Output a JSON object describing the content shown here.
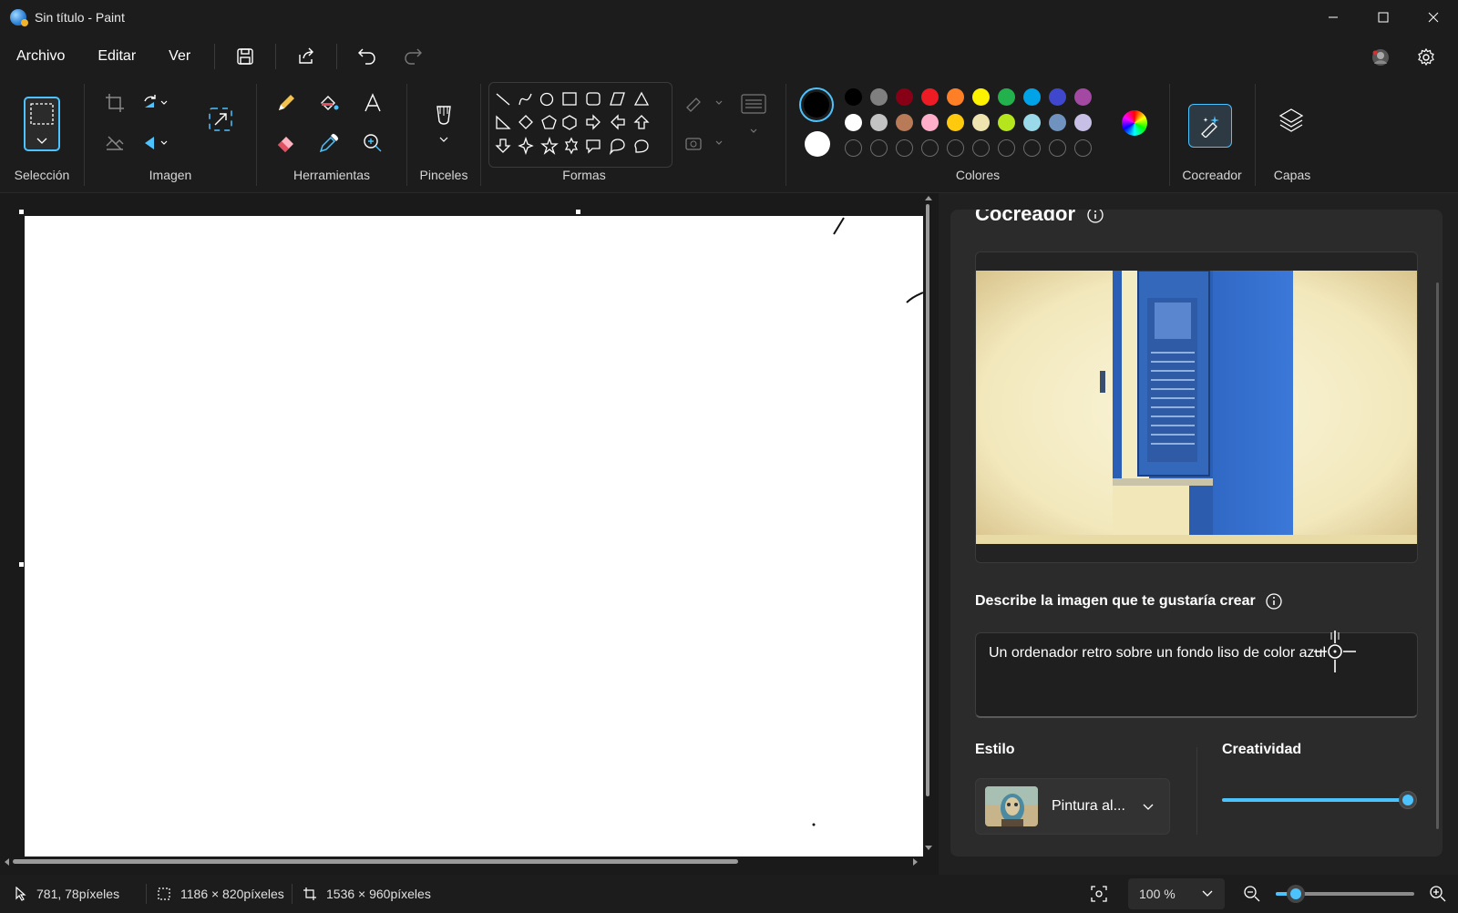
{
  "window": {
    "title": "Sin título - Paint"
  },
  "menu": {
    "file": "Archivo",
    "edit": "Editar",
    "view": "Ver"
  },
  "ribbon": {
    "groups": {
      "selection": "Selección",
      "image": "Imagen",
      "tools": "Herramientas",
      "brushes": "Pinceles",
      "shapes": "Formas",
      "colors": "Colores",
      "cocreator": "Cocreador",
      "layers": "Capas"
    },
    "palette_row1": [
      "#000000",
      "#7f7f7f",
      "#880015",
      "#ed1c24",
      "#ff7f27",
      "#fff200",
      "#22b14c",
      "#00a2e8",
      "#3f48cc",
      "#a349a4"
    ],
    "palette_row2": [
      "#ffffff",
      "#c3c3c3",
      "#b97a57",
      "#ffaec9",
      "#ffc90e",
      "#efe4b0",
      "#b5e61d",
      "#99d9ea",
      "#7092be",
      "#c8bfe7"
    ],
    "primary_color": "#000000",
    "secondary_color": "#ffffff",
    "accent": "#4cc2ff"
  },
  "cocreator": {
    "title": "Cocreador",
    "prompt_label": "Describe la imagen que te gustaría crear",
    "prompt_value": "Un ordenador retro sobre un fondo liso de color azul",
    "style_label": "Estilo",
    "style_value": "Pintura al...",
    "creativity_label": "Creatividad",
    "creativity_level": 1.0
  },
  "status": {
    "cursor_pos": "781, 78píxeles",
    "selection_size": "1186 × 820píxeles",
    "canvas_size": "1536 × 960píxeles",
    "zoom": "100 %"
  }
}
